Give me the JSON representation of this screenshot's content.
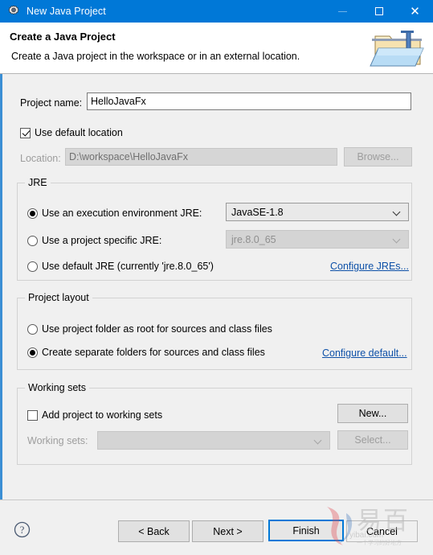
{
  "window": {
    "title": "New Java Project",
    "icon": "gear-icon",
    "controls": {
      "minimize": "–",
      "maximize": "□",
      "close": "✕"
    }
  },
  "header": {
    "title": "Create a Java Project",
    "description": "Create a Java project in the workspace or in an external location.",
    "icon": "java-folder-icon"
  },
  "project": {
    "name_label": "Project name:",
    "name_value": "HelloJavaFx",
    "use_default_location_label": "Use default location",
    "use_default_location_checked": true,
    "location_label": "Location:",
    "location_value": "D:\\workspace\\HelloJavaFx",
    "browse_label": "Browse...",
    "browse_enabled": false
  },
  "jre": {
    "group_title": "JRE",
    "options": [
      {
        "label": "Use an execution environment JRE:",
        "selected": true
      },
      {
        "label": "Use a project specific JRE:",
        "selected": false
      },
      {
        "label": "Use default JRE (currently 'jre.8.0_65')",
        "selected": false
      }
    ],
    "execution_env_value": "JavaSE-1.8",
    "project_jre_value": "jre.8.0_65",
    "configure_link": "Configure JREs..."
  },
  "layout": {
    "group_title": "Project layout",
    "options": [
      {
        "label": "Use project folder as root for sources and class files",
        "selected": false
      },
      {
        "label": "Create separate folders for sources and class files",
        "selected": true
      }
    ],
    "configure_link": "Configure default..."
  },
  "working_sets": {
    "group_title": "Working sets",
    "add_label": "Add project to working sets",
    "add_checked": false,
    "new_label": "New...",
    "sets_label": "Working sets:",
    "sets_value": "",
    "select_label": "Select...",
    "select_enabled": false
  },
  "footer": {
    "help_icon": "help-icon",
    "back_label": "< Back",
    "next_label": "Next >",
    "finish_label": "Finish",
    "cancel_label": "Cancel"
  },
  "watermark": {
    "cn_text": "易百",
    "sub_text": "yibai.com",
    "sub_text2": "一个学习的好地方"
  },
  "colors": {
    "titlebar": "#0078d7",
    "accent": "#3b8fd4",
    "body": "#f0f0f0",
    "link": "#0e51a8"
  }
}
